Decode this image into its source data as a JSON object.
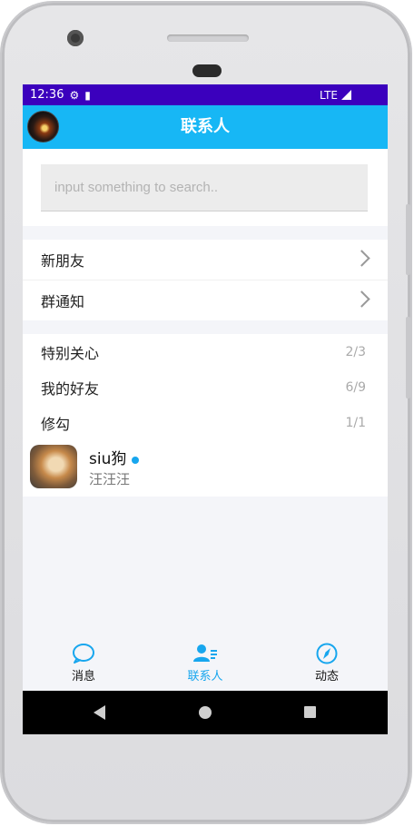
{
  "status_bar": {
    "time": "12:36",
    "network": "LTE"
  },
  "app_bar": {
    "title": "联系人"
  },
  "search": {
    "placeholder": "input something to search.."
  },
  "nav_items": [
    {
      "label": "新朋友"
    },
    {
      "label": "群通知"
    }
  ],
  "groups": [
    {
      "label": "特别关心",
      "count": "2/3"
    },
    {
      "label": "我的好友",
      "count": "6/9"
    },
    {
      "label": "修勾",
      "count": "1/1"
    }
  ],
  "contact": {
    "name": "siu狗",
    "signature": "汪汪汪",
    "online": true
  },
  "tabs": [
    {
      "label": "消息",
      "icon": "chat-bubble-icon",
      "active": false
    },
    {
      "label": "联系人",
      "icon": "contacts-icon",
      "active": true
    },
    {
      "label": "动态",
      "icon": "compass-icon",
      "active": false
    }
  ],
  "colors": {
    "accent": "#17a6ee",
    "app_bar": "#17b7f5",
    "status_bar": "#3b00bd"
  }
}
